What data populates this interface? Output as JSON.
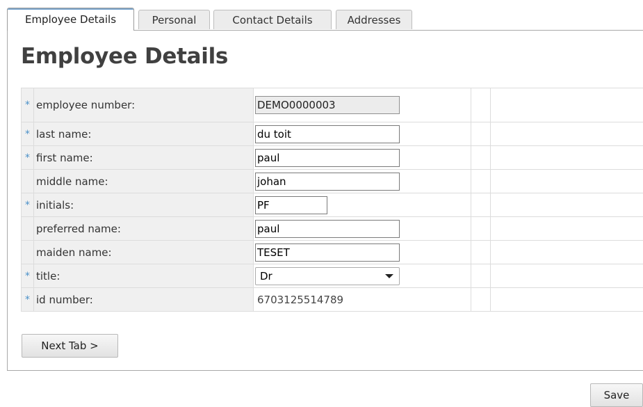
{
  "tabs": [
    {
      "label": "Employee Details",
      "active": true
    },
    {
      "label": "Personal",
      "active": false
    },
    {
      "label": "Contact Details",
      "active": false
    },
    {
      "label": "Addresses",
      "active": false
    }
  ],
  "page_title": "Employee Details",
  "required_marker": "*",
  "fields": {
    "employee_number": {
      "label": "employee number:",
      "value": "DEMO0000003",
      "required": true
    },
    "last_name": {
      "label": "last name:",
      "value": "du toit",
      "required": true
    },
    "first_name": {
      "label": "first name:",
      "value": "paul",
      "required": true
    },
    "middle_name": {
      "label": "middle name:",
      "value": "johan",
      "required": false
    },
    "initials": {
      "label": "initials:",
      "value": "PF",
      "required": true
    },
    "preferred_name": {
      "label": "preferred name:",
      "value": "paul",
      "required": false
    },
    "maiden_name": {
      "label": "maiden name:",
      "value": "TESET",
      "required": false
    },
    "title": {
      "label": "title:",
      "value": "Dr",
      "required": true
    },
    "id_number": {
      "label": "id number:",
      "value": "6703125514789",
      "required": true
    }
  },
  "buttons": {
    "next_tab": "Next Tab >",
    "save": "Save"
  },
  "colors": {
    "required_star": "#4a90c8",
    "label_bg": "#f0f0f0",
    "active_tab_accent": "#7aa5cc"
  }
}
